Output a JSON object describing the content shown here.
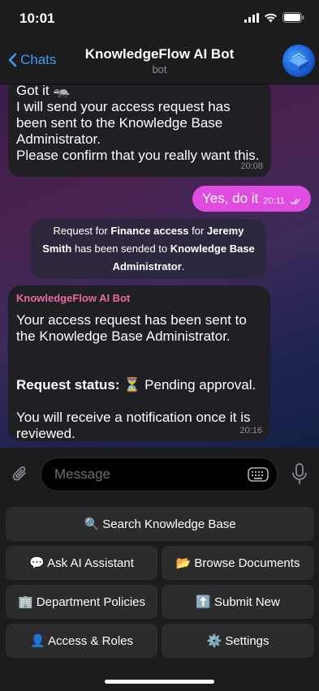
{
  "status": {
    "time": "10:01"
  },
  "nav": {
    "back_label": "Chats",
    "title": "KnowledgeFlow AI Bot",
    "subtitle": "bot"
  },
  "messages": {
    "m1": {
      "text": "Got it 🦡\nI will send your access request has been sent to the Knowledge Base Administrator.\nPlease confirm that you really want this.",
      "time": "20:08"
    },
    "m2": {
      "text": "Yes, do it",
      "time": "20:11"
    },
    "m3": {
      "t1": "Request for ",
      "b1": "Finance access",
      "t2": " for ",
      "b2": "Jeremy Smith",
      "t3": " has been sended to ",
      "b3": "Knowledge Base Administrator",
      "t4": "."
    },
    "m4": {
      "sender": "KnowledgeFlow AI Bot",
      "p1": "Your access request has been sent to the Knowledge Base Administrator.",
      "status_label": "Request status:",
      "status_value": " ⏳ Pending approval.",
      "p3": "You will receive a notification once it is reviewed.",
      "time": "20:16"
    }
  },
  "composer": {
    "placeholder": "Message"
  },
  "keyboard": {
    "b1": "🔍 Search Knowledge Base",
    "b2": "💬 Ask AI Assistant",
    "b3": "📂 Browse Documents",
    "b4": "🏢 Department Policies",
    "b5": "⬆️ Submit New",
    "b6": "👤 Access & Roles",
    "b7": "⚙️ Settings"
  },
  "colors": {
    "accent": "#3e9bf5",
    "outgoing": "#e04be0",
    "sender": "#e86aa6"
  }
}
